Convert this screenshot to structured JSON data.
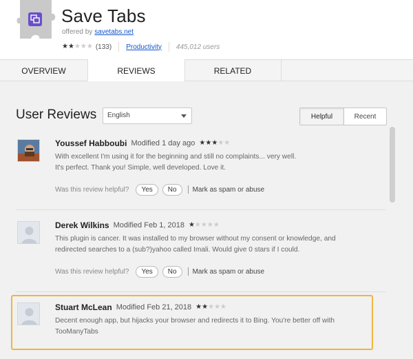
{
  "header": {
    "title": "Save Tabs",
    "offered_prefix": "offered by",
    "offered_link": "savetabs.net",
    "rating_stars": 2,
    "rating_count": "(133)",
    "category": "Productivity",
    "users": "445,012 users"
  },
  "tabs": [
    {
      "label": "OVERVIEW",
      "active": false
    },
    {
      "label": "REVIEWS",
      "active": true
    },
    {
      "label": "RELATED",
      "active": false
    }
  ],
  "reviews_section": {
    "title": "User Reviews",
    "language": "English",
    "sort_helpful": "Helpful",
    "sort_recent": "Recent",
    "sort_selected": "Helpful"
  },
  "reviews": [
    {
      "name": "Youssef Habboubi",
      "date": "Modified 1 day ago",
      "stars": 3,
      "line1": "With excellent I'm using it for the beginning and still no complaints... very well.",
      "line2": "It's perfect. Thank you! Simple, well developed. Love it.",
      "helpful_q": "Was this review helpful?",
      "yes": "Yes",
      "no": "No",
      "spam": "Mark as spam or abuse"
    },
    {
      "name": "Derek Wilkins",
      "date": "Modified Feb 1, 2018",
      "stars": 1,
      "line1": "This plugin is cancer. It was installed to my browser without my consent or knowledge, and",
      "line2": "redirected searches to a (sub?)yahoo called Imali. Would give 0 stars if I could.",
      "helpful_q": "Was this review helpful?",
      "yes": "Yes",
      "no": "No",
      "spam": "Mark as spam or abuse"
    },
    {
      "name": "Stuart McLean",
      "date": "Modified Feb 21, 2018",
      "stars": 2,
      "line1": "Decent enough app, but hijacks your browser and redirects it to Bing. You're better off with",
      "line2": "TooManyTabs"
    }
  ],
  "colors": {
    "link": "#1155cc",
    "highlight": "#f0b53a",
    "extension_icon": "#6a4fc9"
  }
}
